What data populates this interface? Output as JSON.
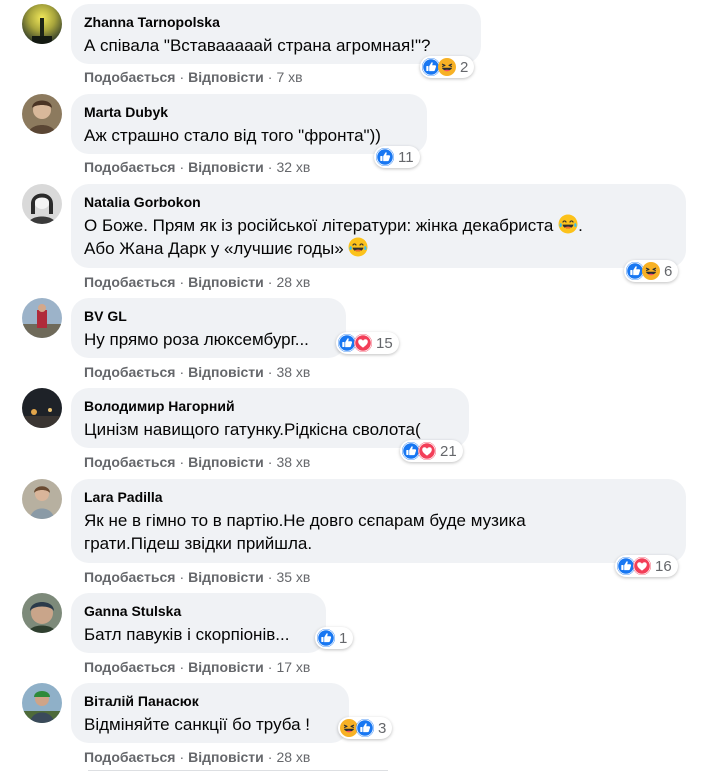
{
  "labels": {
    "like": "Подобається",
    "reply": "Відповісти",
    "sep": "·"
  },
  "comments": [
    {
      "author": "Zhanna Tarnopolska",
      "text": "А співала \"Вставааааай страна агромная!\"?",
      "time": "7 хв",
      "reactions": [
        "like",
        "haha"
      ],
      "count": "2"
    },
    {
      "author": "Marta Dubyk",
      "text": "Аж страшно стало від того \"фронта\"))",
      "time": "32 хв",
      "reactions": [
        "like"
      ],
      "count": "11"
    },
    {
      "author": "Natalia Gorbokon",
      "text_line1": "О Боже. Прям як із російської літератури: жінка декабриста",
      "text_line1_end": ".",
      "text_line2": "Або Жана Дарк у «лучшиє годы»",
      "inline_emoji": "tears-of-joy",
      "time": "28 хв",
      "reactions": [
        "like",
        "haha"
      ],
      "count": "6"
    },
    {
      "author": "BV GL",
      "text": "Ну прямо роза люксембург...",
      "time": "38 хв",
      "reactions": [
        "like",
        "love"
      ],
      "count": "15"
    },
    {
      "author": "Володимир Нагорний",
      "text": "Цинізм навищого гатунку.Рідкісна сволота(",
      "time": "38 хв",
      "reactions": [
        "like",
        "love"
      ],
      "count": "21"
    },
    {
      "author": "Lara Padilla",
      "text": "Як не в гімно то в партію.Не довго сєпарам буде музика\nграти.Підеш звідки прийшла.",
      "time": "35 хв",
      "reactions": [
        "like",
        "love"
      ],
      "count": "16"
    },
    {
      "author": "Ganna Stulska",
      "text": "Батл павуків і скорпіонів...",
      "time": "17 хв",
      "reactions": [
        "like"
      ],
      "count": "1"
    },
    {
      "author": "Віталій Панасюк",
      "text": "Відміняйте санкції бо труба !",
      "time": "28 хв",
      "reactions": [
        "haha",
        "like"
      ],
      "count": "3"
    }
  ],
  "colors": {
    "like": "#1877f2",
    "love": "#f33e58",
    "haha": "#f7b125",
    "bubble": "#f0f2f5",
    "meta": "#65676b"
  }
}
